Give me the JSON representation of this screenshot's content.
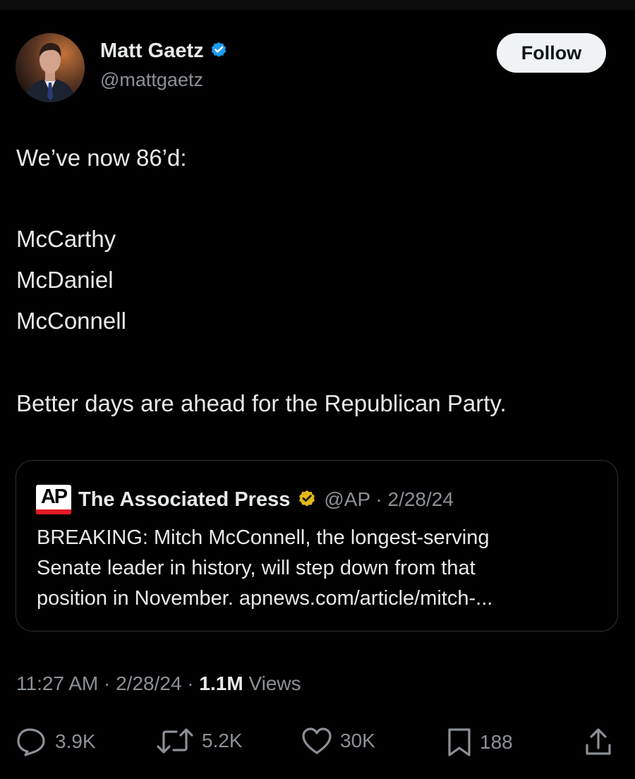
{
  "author": {
    "display_name": "Matt Gaetz",
    "handle": "@mattgaetz",
    "verified_badge": "blue-check-icon"
  },
  "follow_label": "Follow",
  "tweet_text": {
    "line1": "We’ve now 86’d:",
    "line2": "McCarthy",
    "line3": "McDaniel",
    "line4": "McConnell",
    "line5": "Better days are ahead for the Republican Party."
  },
  "quoted": {
    "logo_text": "AP",
    "name": "The Associated Press",
    "verified_badge": "gold-check-icon",
    "meta": "@AP · 2/28/24",
    "text_line1": "BREAKING: Mitch McConnell, the longest-serving",
    "text_line2": "Senate leader in history, will step down from that",
    "text_line3": "position in November.  apnews.com/article/mitch-..."
  },
  "meta": {
    "time_date": "11:27 AM · 2/28/24 · ",
    "views_count": "1.1M",
    "views_label": " Views"
  },
  "actions": {
    "replies": "3.9K",
    "reposts": "5.2K",
    "likes": "30K",
    "bookmarks": "188"
  },
  "colors": {
    "background": "#000000",
    "text": "#e7e9ea",
    "muted": "#8b9197",
    "verified_blue": "#1d9bf0",
    "verified_gold": "#e2b719",
    "ap_red": "#e31b23"
  }
}
